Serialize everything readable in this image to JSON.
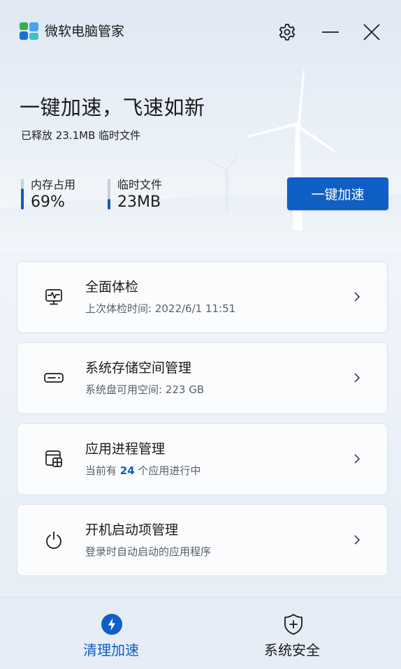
{
  "app": {
    "title": "微软电脑管家",
    "brand_colors": [
      "#2fb34a",
      "#4aa3f0",
      "#1a6fd6",
      "#35c2c9"
    ]
  },
  "titlebar": {
    "settings_icon": "gear-icon",
    "minimize_icon": "minimize-icon",
    "close_icon": "close-icon"
  },
  "hero": {
    "title": "一键加速，飞速如新",
    "subtitle": "已释放 23.1MB 临时文件",
    "stats": [
      {
        "label": "内存占用",
        "value": "69%",
        "fill_fraction": 0.69
      },
      {
        "label": "临时文件",
        "value": "23MB",
        "fill_fraction": 0.35
      }
    ],
    "boost_button": "一键加速"
  },
  "cards": [
    {
      "title": "全面体检",
      "subtitle": "上次体检时间: 2022/6/1 11:51",
      "icon": "monitor-health-icon"
    },
    {
      "title": "系统存储空间管理",
      "subtitle": "系统盘可用空间: 223 GB",
      "icon": "storage-drive-icon"
    },
    {
      "title": "应用进程管理",
      "subtitle_prefix": "当前有 ",
      "subtitle_count": "24",
      "subtitle_suffix": " 个应用进行中",
      "icon": "app-process-icon"
    },
    {
      "title": "开机启动项管理",
      "subtitle": "登录时自动启动的应用程序",
      "icon": "power-icon"
    }
  ],
  "bottom_nav": [
    {
      "label": "清理加速",
      "icon": "lightning-icon",
      "active": true
    },
    {
      "label": "系统安全",
      "icon": "shield-plus-icon",
      "active": false
    }
  ],
  "colors": {
    "accent": "#0f5fc4",
    "card_bg": "#fbfcfe",
    "text_secondary": "#5a5f66"
  }
}
